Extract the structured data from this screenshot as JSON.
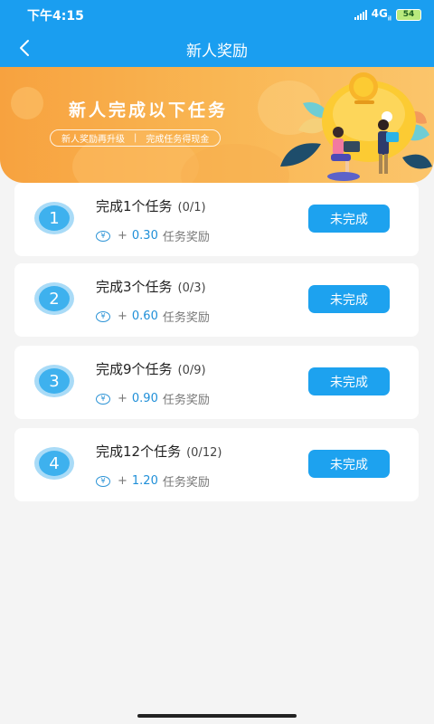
{
  "status_bar": {
    "time": "下午4:15",
    "network": "4G",
    "network_sub": "il",
    "battery": "54"
  },
  "header": {
    "title": "新人奖励",
    "back_icon": "chevron-left-icon"
  },
  "banner": {
    "title": "新人完成以下任务",
    "sub_left": "新人奖励再升级",
    "divider": "|",
    "sub_right": "完成任务得现金"
  },
  "tasks": [
    {
      "index": "1",
      "title": "完成1个任务",
      "progress": "(0/1)",
      "plus": "+",
      "amount": "0.30",
      "reward_label": "任务奖励",
      "button": "未完成"
    },
    {
      "index": "2",
      "title": "完成3个任务",
      "progress": "(0/3)",
      "plus": "+",
      "amount": "0.60",
      "reward_label": "任务奖励",
      "button": "未完成"
    },
    {
      "index": "3",
      "title": "完成9个任务",
      "progress": "(0/9)",
      "plus": "+",
      "amount": "0.90",
      "reward_label": "任务奖励",
      "button": "未完成"
    },
    {
      "index": "4",
      "title": "完成12个任务",
      "progress": "(0/12)",
      "plus": "+",
      "amount": "1.20",
      "reward_label": "任务奖励",
      "button": "未完成"
    }
  ],
  "yen_symbol": "¥",
  "colors": {
    "primary": "#1a9ef0",
    "banner": "#f9b653",
    "amount": "#1f8fd8",
    "battery": "#b9ea7d"
  }
}
